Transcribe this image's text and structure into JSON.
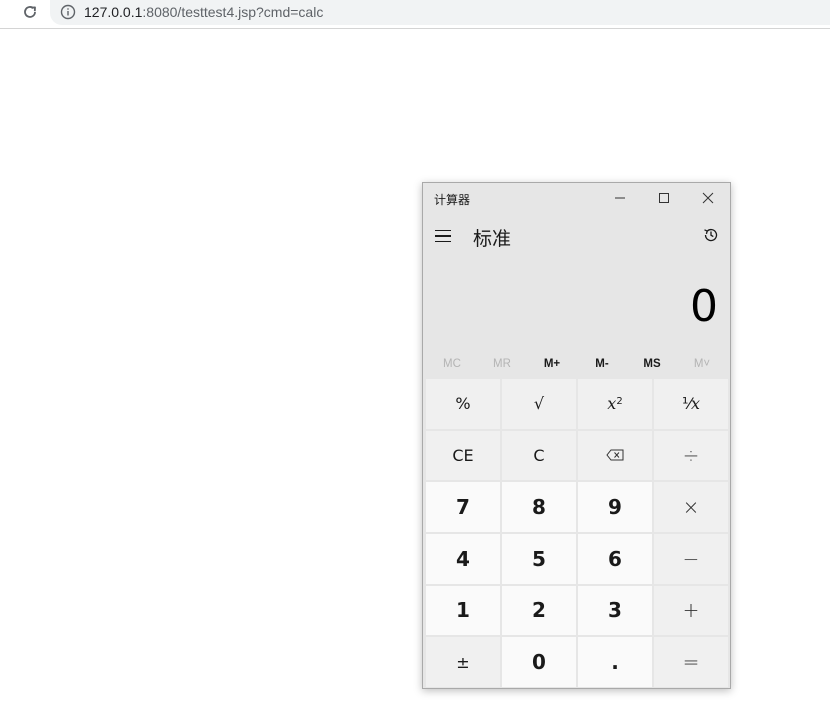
{
  "browser": {
    "url_host": "127.0.0.1",
    "url_rest": ":8080/testtest4.jsp?cmd=calc"
  },
  "calculator": {
    "window_title": "计算器",
    "mode_title": "标准",
    "display_value": "0",
    "memory_buttons": [
      {
        "label": "MC",
        "enabled": false
      },
      {
        "label": "MR",
        "enabled": false
      },
      {
        "label": "M+",
        "enabled": true
      },
      {
        "label": "M-",
        "enabled": true
      },
      {
        "label": "MS",
        "enabled": true
      },
      {
        "label": "M˅",
        "enabled": false
      }
    ],
    "keys": [
      {
        "label": "%",
        "type": "fn"
      },
      {
        "label": "√",
        "type": "fn"
      },
      {
        "label": "x²",
        "type": "fn"
      },
      {
        "label": "¹⁄x",
        "type": "fn"
      },
      {
        "label": "CE",
        "type": "fn"
      },
      {
        "label": "C",
        "type": "fn"
      },
      {
        "label": "⌫",
        "type": "fn"
      },
      {
        "label": "÷",
        "type": "op"
      },
      {
        "label": "7",
        "type": "digit"
      },
      {
        "label": "8",
        "type": "digit"
      },
      {
        "label": "9",
        "type": "digit"
      },
      {
        "label": "×",
        "type": "op"
      },
      {
        "label": "4",
        "type": "digit"
      },
      {
        "label": "5",
        "type": "digit"
      },
      {
        "label": "6",
        "type": "digit"
      },
      {
        "label": "−",
        "type": "op"
      },
      {
        "label": "1",
        "type": "digit"
      },
      {
        "label": "2",
        "type": "digit"
      },
      {
        "label": "3",
        "type": "digit"
      },
      {
        "label": "+",
        "type": "op"
      },
      {
        "label": "±",
        "type": "fn"
      },
      {
        "label": "0",
        "type": "digit"
      },
      {
        "label": ".",
        "type": "digit"
      },
      {
        "label": "=",
        "type": "op"
      }
    ]
  }
}
